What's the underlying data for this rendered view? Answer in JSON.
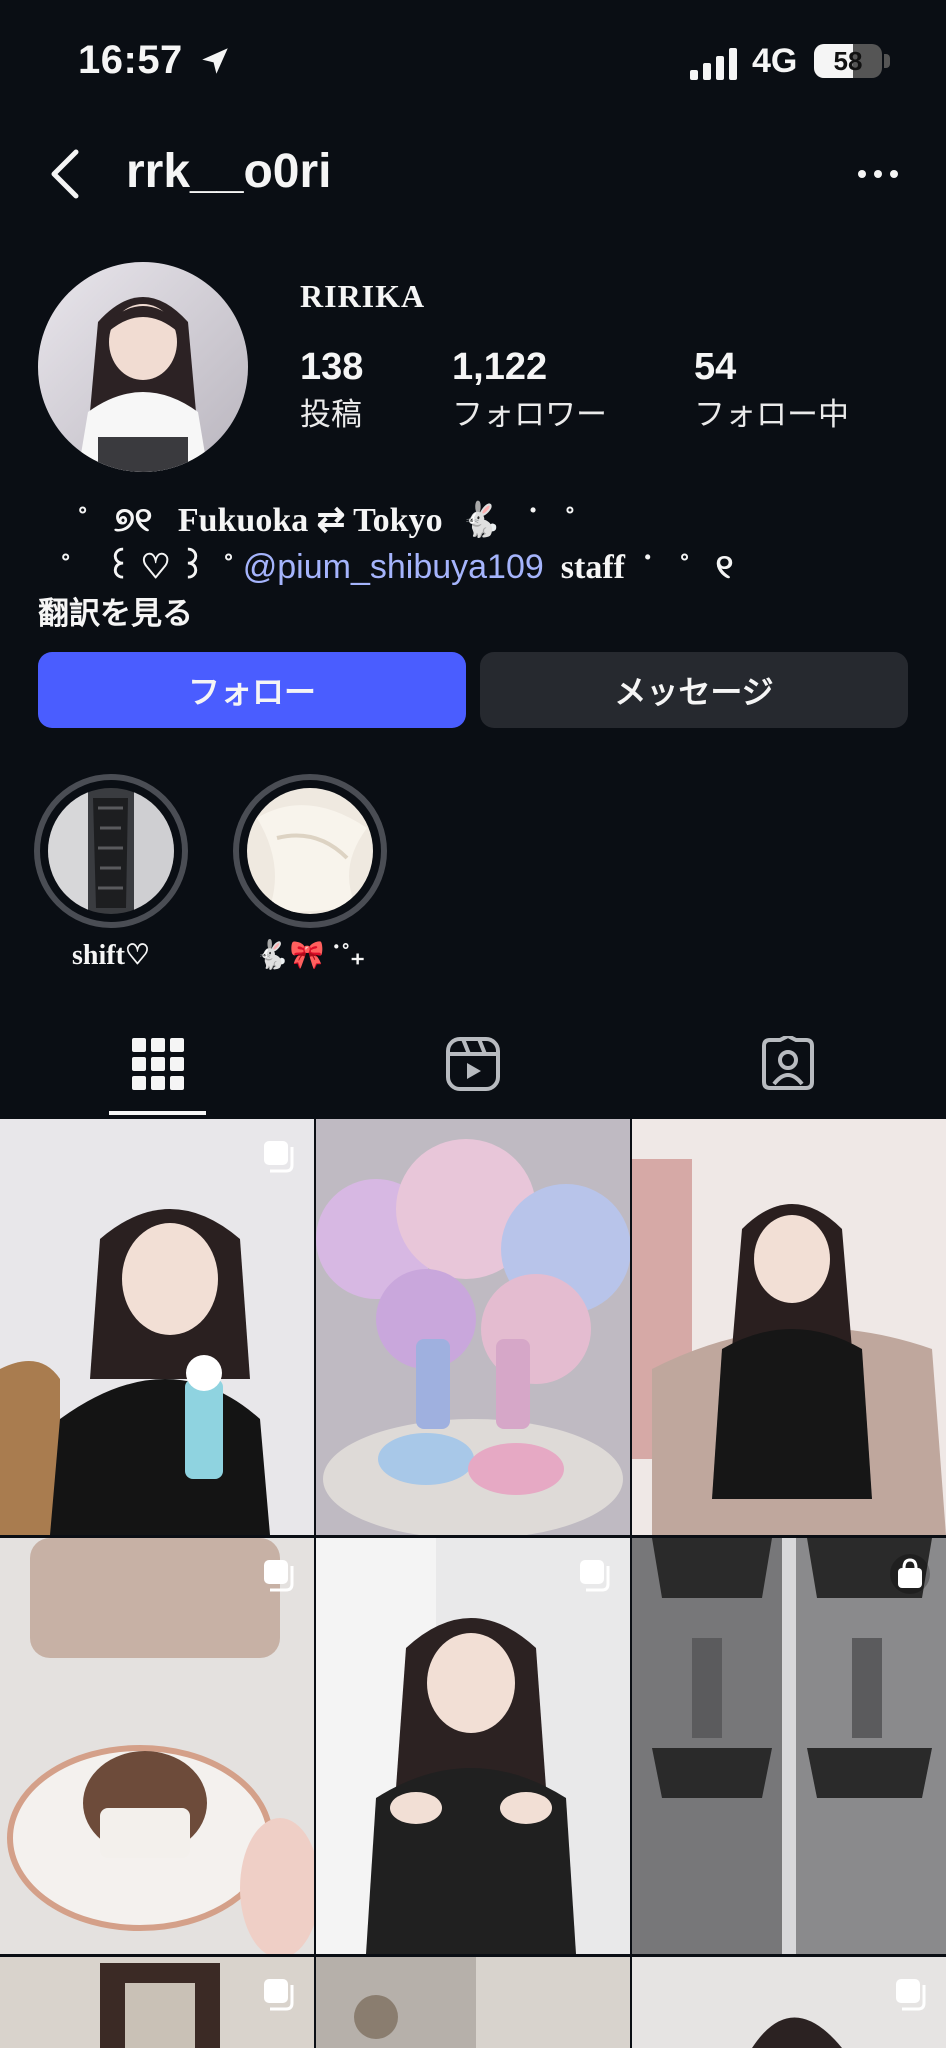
{
  "status_bar": {
    "time": "16:57",
    "network": "4G",
    "battery": "58",
    "battery_level": 0.58
  },
  "header": {
    "username": "rrk__o0ri"
  },
  "profile": {
    "display_name": "RIRIKA",
    "stats": [
      {
        "value": "138",
        "label": "投稿"
      },
      {
        "value": "1,122",
        "label": "フォロワー"
      },
      {
        "value": "54",
        "label": "フォロー中"
      }
    ],
    "bio_line1": "  ˚   ୭୧   Fukuoka ⇄ Tokyo  🐇   ˙   ˚",
    "bio_line2_pre": "˚    ꒰ ♡ ꒱  ˚ ",
    "bio_mention": "@pium_shibuya109",
    "bio_line2_post": "  staff  ˙   ˚   ୧",
    "translate": "翻訳を見る"
  },
  "buttons": {
    "follow": "フォロー",
    "message": "メッセージ"
  },
  "highlights": [
    {
      "label": "shift♡"
    },
    {
      "label": "🐇🎀 ˙˚₊"
    }
  ],
  "tabs": [
    "grid-icon",
    "reels-icon",
    "tagged-icon"
  ],
  "colors": {
    "background": "#0a0e14",
    "accent": "#4a5dff",
    "mention": "#a5b4fc",
    "secondary_button": "#26292f"
  }
}
